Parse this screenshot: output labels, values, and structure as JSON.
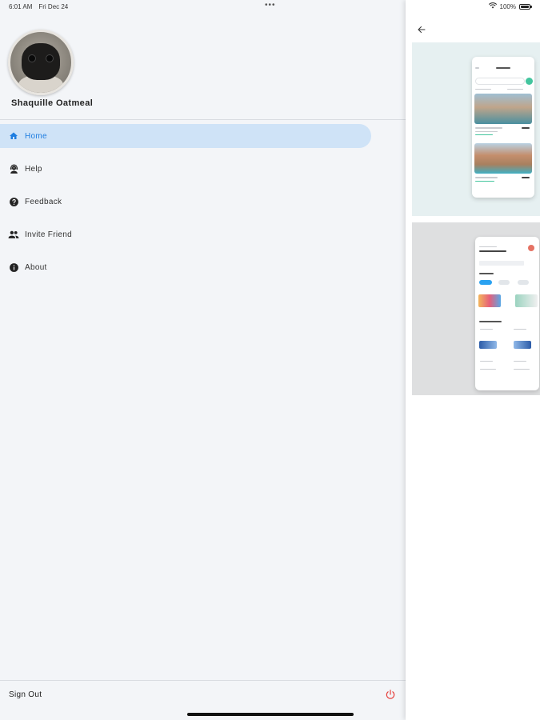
{
  "status_bar": {
    "time": "6:01 AM",
    "date": "Fri Dec 24",
    "dots": "•••",
    "battery_text": "100%",
    "battery_level": 1.0
  },
  "drawer": {
    "user_name": "Shaquille Oatmeal",
    "nav_items": [
      {
        "label": "Home",
        "icon": "home-icon",
        "active": true
      },
      {
        "label": "Help",
        "icon": "support-agent-icon",
        "active": false
      },
      {
        "label": "Feedback",
        "icon": "help-circle-icon",
        "active": false
      },
      {
        "label": "Invite Friend",
        "icon": "people-icon",
        "active": false
      },
      {
        "label": "About",
        "icon": "info-icon",
        "active": false
      }
    ],
    "sign_out_label": "Sign Out"
  },
  "right_panel": {
    "back_icon": "arrow-left-icon",
    "cards": [
      {
        "name": "hotel-app-preview"
      },
      {
        "name": "design-course-app-preview"
      }
    ]
  },
  "colors": {
    "accent": "#1e7de0",
    "active_bg": "#cfe3f7",
    "power": "#e53935",
    "drawer_bg": "#f3f5f8"
  }
}
